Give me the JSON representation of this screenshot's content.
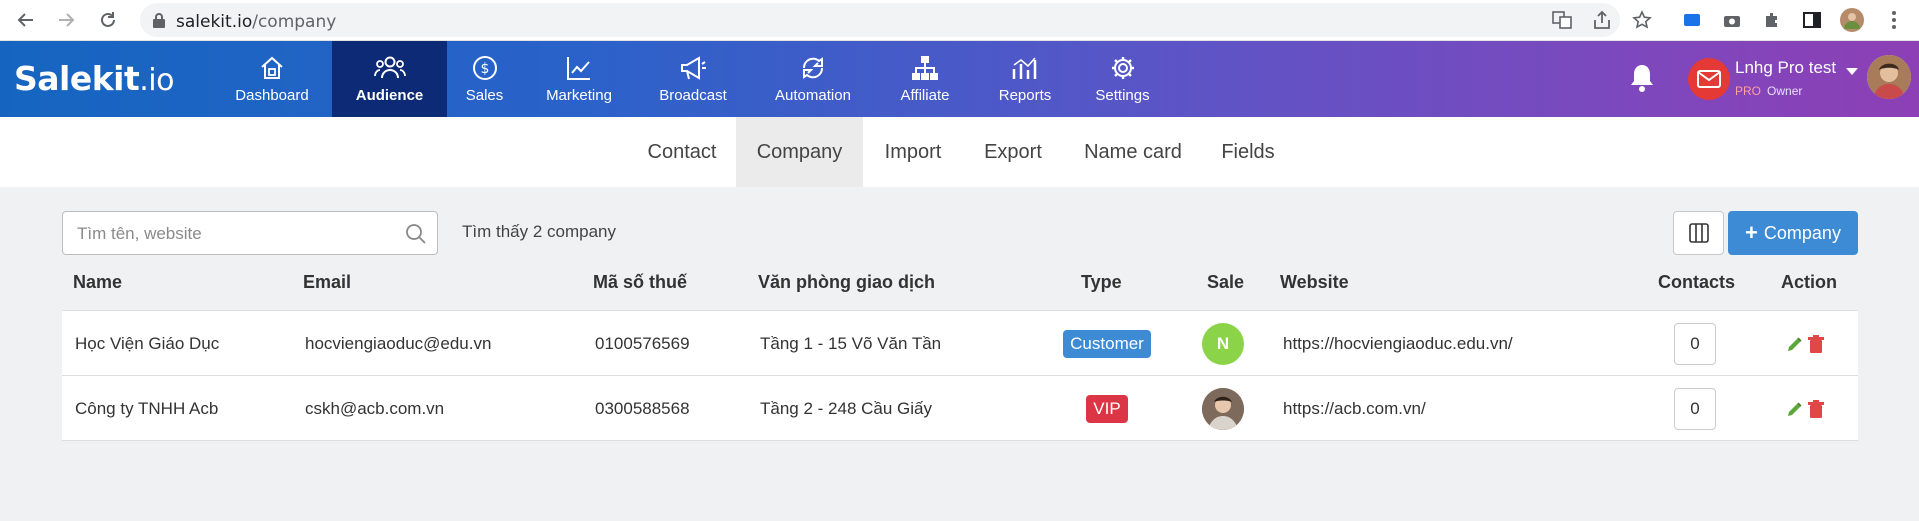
{
  "browser": {
    "url_host": "salekit.io",
    "url_path": "/company"
  },
  "app": {
    "logo_main": "Salekit",
    "logo_suffix": ".io",
    "nav": [
      {
        "label": "Dashboard",
        "icon": "home-icon"
      },
      {
        "label": "Audience",
        "icon": "users-icon",
        "active": true
      },
      {
        "label": "Sales",
        "icon": "dollar-icon"
      },
      {
        "label": "Marketing",
        "icon": "trend-icon"
      },
      {
        "label": "Broadcast",
        "icon": "megaphone-icon"
      },
      {
        "label": "Automation",
        "icon": "sync-icon"
      },
      {
        "label": "Affiliate",
        "icon": "network-icon"
      },
      {
        "label": "Reports",
        "icon": "chart-icon"
      },
      {
        "label": "Settings",
        "icon": "gear-icon"
      }
    ],
    "user": {
      "name": "Lnhg Pro test",
      "plan": "PRO",
      "role": "Owner"
    },
    "colors": {
      "header_start": "#1565c0",
      "header_end": "#8d3fb6",
      "active_nav": "#0c2a75",
      "primary_button": "#3d8bd4",
      "customer_badge": "#3d8bd4",
      "vip_badge": "#dc3545",
      "sale_n": "#8bd44a"
    }
  },
  "subnav": {
    "tabs": [
      {
        "label": "Contact"
      },
      {
        "label": "Company",
        "active": true
      },
      {
        "label": "Import"
      },
      {
        "label": "Export"
      },
      {
        "label": "Name card"
      },
      {
        "label": "Fields"
      }
    ]
  },
  "toolbar": {
    "search_placeholder": "Tìm tên, website",
    "found_text": "Tìm thấy 2 company",
    "add_label": "Company"
  },
  "table": {
    "columns": [
      "Name",
      "Email",
      "Mã số thuế",
      "Văn phòng giao dịch",
      "Type",
      "Sale",
      "Website",
      "Contacts",
      "Action"
    ],
    "rows": [
      {
        "name": "Học Viện Giáo Dục",
        "email": "hocviengiaoduc@edu.vn",
        "tax": "0100576569",
        "office": "Tầng 1 - 15 Võ Văn Tần",
        "type": "Customer",
        "sale": "N",
        "website": "https://hocviengiaoduc.edu.vn/",
        "contacts": "0"
      },
      {
        "name": "Công ty TNHH Acb",
        "email": "cskh@acb.com.vn",
        "tax": "0300588568",
        "office": "Tầng 2 - 248 Cầu Giấy",
        "type": "VIP",
        "sale": "",
        "website": "https://acb.com.vn/",
        "contacts": "0"
      }
    ]
  }
}
